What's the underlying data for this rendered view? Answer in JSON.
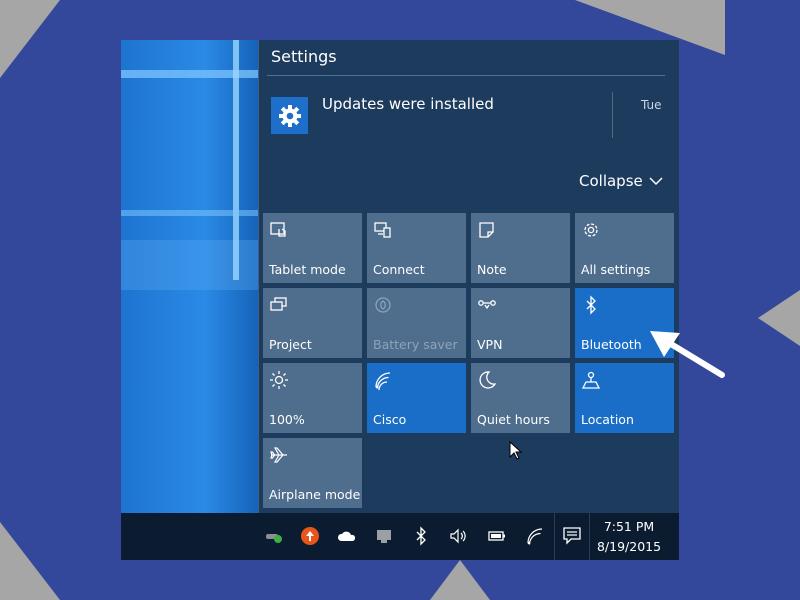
{
  "panel": {
    "title": "Settings"
  },
  "notification": {
    "icon": "gear-icon",
    "text": "Updates were installed",
    "time": "Tue"
  },
  "collapse_label": "Collapse",
  "quick_actions": [
    {
      "label": "Tablet mode",
      "icon": "tablet-mode-icon",
      "state": "off"
    },
    {
      "label": "Connect",
      "icon": "connect-icon",
      "state": "off"
    },
    {
      "label": "Note",
      "icon": "note-icon",
      "state": "off"
    },
    {
      "label": "All settings",
      "icon": "gear-icon",
      "state": "off"
    },
    {
      "label": "Project",
      "icon": "project-icon",
      "state": "off"
    },
    {
      "label": "Battery saver",
      "icon": "battery-saver-icon",
      "state": "disabled"
    },
    {
      "label": "VPN",
      "icon": "vpn-icon",
      "state": "off"
    },
    {
      "label": "Bluetooth",
      "icon": "bluetooth-icon",
      "state": "on"
    },
    {
      "label": "100%",
      "icon": "brightness-icon",
      "state": "off"
    },
    {
      "label": "Cisco",
      "icon": "wifi-icon",
      "state": "on"
    },
    {
      "label": "Quiet hours",
      "icon": "moon-icon",
      "state": "off"
    },
    {
      "label": "Location",
      "icon": "location-icon",
      "state": "on"
    },
    {
      "label": "Airplane mode",
      "icon": "airplane-icon",
      "state": "off"
    }
  ],
  "taskbar": {
    "tray_icons": [
      "network-status-icon",
      "update-icon",
      "onedrive-icon",
      "display-icon",
      "bluetooth-icon",
      "volume-icon",
      "battery-icon",
      "wifi-icon"
    ],
    "action_center_icon": "action-center-icon",
    "time": "7:51 PM",
    "date": "8/19/2015"
  },
  "colors": {
    "page_background": "#33489a",
    "panel_background": "#1d3b5d",
    "tile_off": "#4f6d8c",
    "tile_on": "#1a6ec8",
    "taskbar": "#0b1c31"
  }
}
